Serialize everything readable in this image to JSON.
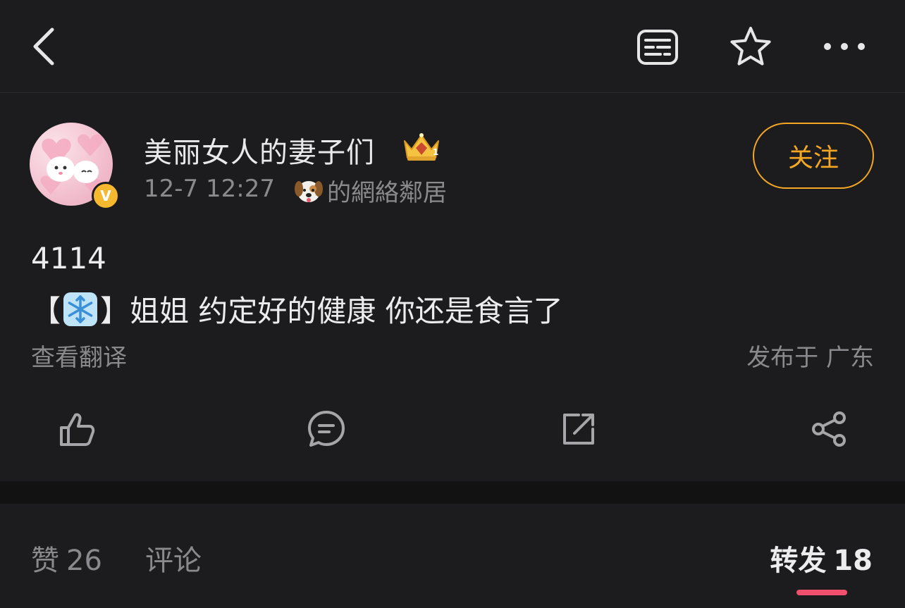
{
  "header": {
    "back_icon": "chevron-left-icon",
    "reader_icon": "reader-icon",
    "star_icon": "star-icon",
    "more_icon": "more-horizontal-icon"
  },
  "post": {
    "username": "美丽女人的妻子们",
    "crown_badge": "crown-badge",
    "verified_badge": "V",
    "time": "12-7 12:27",
    "source": "的網絡鄰居",
    "follow_label": "关注",
    "line1": "4114",
    "line2_open": "【",
    "line2_close": "】",
    "line2_text": "姐姐 约定好的健康 你还是食言了",
    "translate_label": "查看翻译",
    "location": "发布于 广东",
    "accent_color": "#f5a623"
  },
  "actions": {
    "like_icon": "thumbs-up-icon",
    "comment_icon": "comment-icon",
    "repost_icon": "repost-icon",
    "share_icon": "share-icon"
  },
  "tabs": {
    "like_label": "赞",
    "like_count": "26",
    "comment_label": "评论",
    "repost_label": "转发",
    "repost_count": "18",
    "indicator_color": "#f0506e"
  }
}
